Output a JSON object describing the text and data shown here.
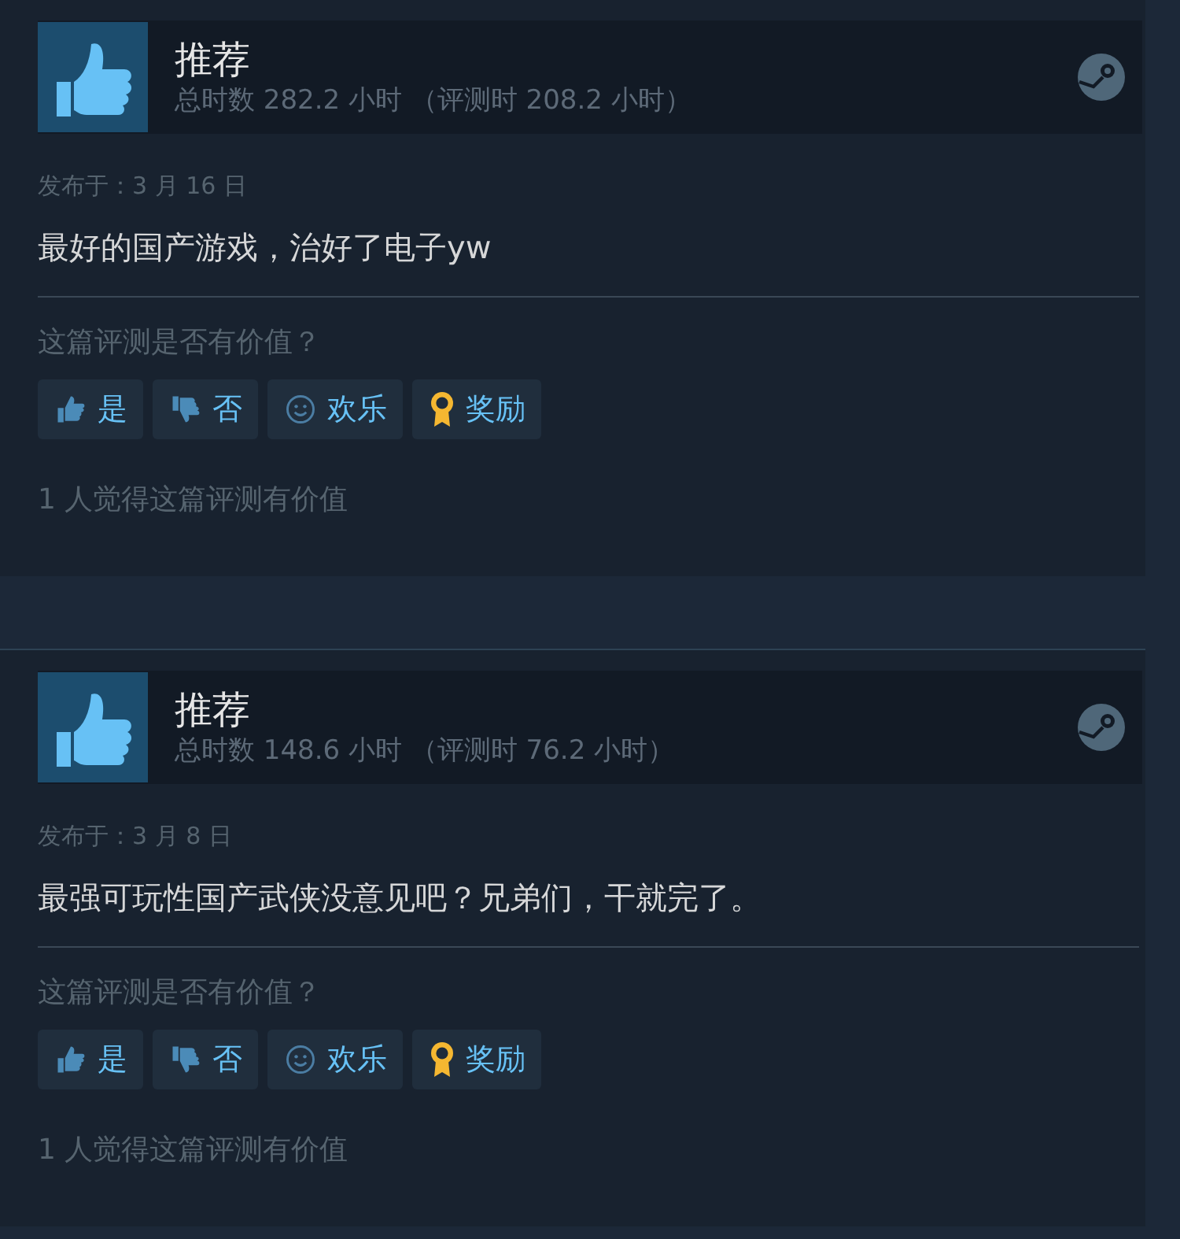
{
  "reviews": [
    {
      "recommendation": "推荐",
      "recommended": true,
      "hours": "总时数 282.2 小时 （评测时 208.2 小时）",
      "date": "发布于：3 月 16 日",
      "text": "最好的国产游戏，治好了电子yw",
      "question": "这篇评测是否有价值？",
      "buttons": [
        {
          "kind": "yes",
          "label": "是"
        },
        {
          "kind": "no",
          "label": "否"
        },
        {
          "kind": "funny",
          "label": "欢乐"
        },
        {
          "kind": "award",
          "label": "奖励"
        }
      ],
      "helpful": "1 人觉得这篇评测有价值"
    },
    {
      "recommendation": "推荐",
      "recommended": true,
      "hours": "总时数 148.6 小时 （评测时 76.2 小时）",
      "date": "发布于：3 月 8 日",
      "text": "最强可玩性国产武侠没意见吧？兄弟们，干就完了。",
      "question": "这篇评测是否有价值？",
      "buttons": [
        {
          "kind": "yes",
          "label": "是"
        },
        {
          "kind": "no",
          "label": "否"
        },
        {
          "kind": "funny",
          "label": "欢乐"
        },
        {
          "kind": "award",
          "label": "奖励"
        }
      ],
      "helpful": "1 人觉得这篇评测有价值"
    }
  ]
}
